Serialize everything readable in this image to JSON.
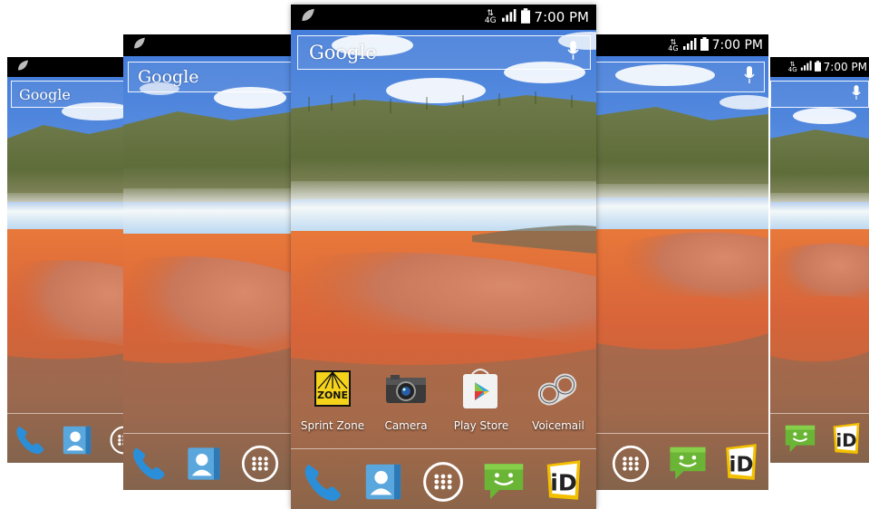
{
  "status_bar": {
    "network": "4G",
    "time": "7:00 PM"
  },
  "search_widget": {
    "logo": "Google",
    "mic_icon": "microphone-icon"
  },
  "apps": [
    {
      "label": "Sprint Zone",
      "icon": "sprint-zone-icon"
    },
    {
      "label": "Camera",
      "icon": "camera-icon"
    },
    {
      "label": "Play Store",
      "icon": "play-store-icon"
    },
    {
      "label": "Voicemail",
      "icon": "voicemail-icon"
    }
  ],
  "dock": [
    {
      "icon": "phone-icon"
    },
    {
      "icon": "contacts-icon"
    },
    {
      "icon": "app-drawer-icon"
    },
    {
      "icon": "messaging-icon"
    },
    {
      "icon": "id-icon"
    }
  ],
  "zone_badge": "ZONE",
  "id_badge": "iD"
}
